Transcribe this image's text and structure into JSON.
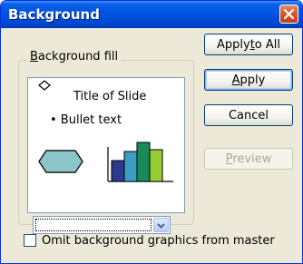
{
  "dialog": {
    "title": "Background",
    "close_icon": "close-icon",
    "accent_color": "#0054e3"
  },
  "fill_group": {
    "label_prefix": "",
    "label_accel": "B",
    "label_rest": "ackground fill",
    "preview": {
      "title_text": "Title of Slide",
      "bullet_text": "•  Bullet text"
    },
    "combo_value": ""
  },
  "buttons": {
    "apply_to_all": {
      "pre": "Apply ",
      "accel": "t",
      "post": "o All"
    },
    "apply": {
      "pre": "",
      "accel": "A",
      "post": "pply"
    },
    "cancel": {
      "pre": "Cancel",
      "accel": "",
      "post": ""
    },
    "preview": {
      "pre": "",
      "accel": "P",
      "post": "review"
    }
  },
  "omit_checkbox": {
    "checked": false,
    "label_pre": "Omit background ",
    "label_accel": "g",
    "label_post": "raphics from master"
  }
}
